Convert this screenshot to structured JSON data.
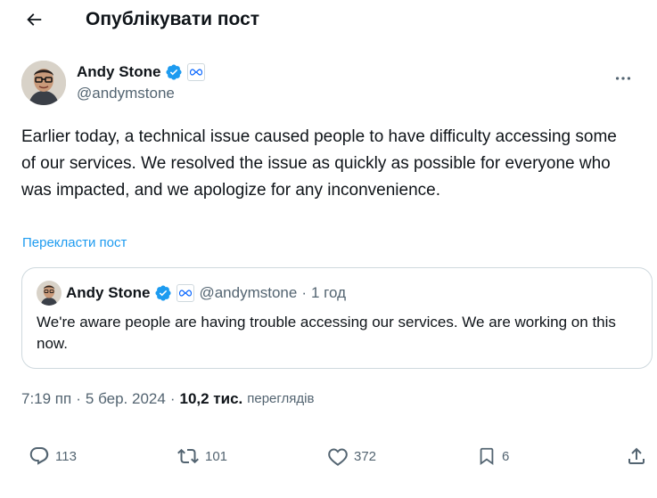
{
  "header": {
    "title": "Опублікувати пост"
  },
  "post": {
    "author_name": "Andy Stone",
    "author_handle": "@andymstone",
    "text": "Earlier today, a technical issue caused people to have difficulty accessing some of our services. We resolved the issue as quickly as possible for everyone who was impacted, and we apologize for any inconvenience.",
    "translate_label": "Перекласти пост",
    "time": "7:19 пп",
    "date": "5 бер. 2024",
    "views_count": "10,2 тис.",
    "views_label": "переглядів",
    "separator": "·"
  },
  "quote": {
    "author_name": "Andy Stone",
    "author_handle": "@andymstone",
    "separator": "·",
    "time_ago": "1 год",
    "text": "We're aware people are having trouble accessing our services. We are working on this now."
  },
  "actions": {
    "replies": "113",
    "reposts": "101",
    "likes": "372",
    "bookmarks": "6"
  },
  "colors": {
    "accent": "#1d9bf0",
    "secondary_text": "#536471",
    "verified": "#1d9bf0"
  }
}
